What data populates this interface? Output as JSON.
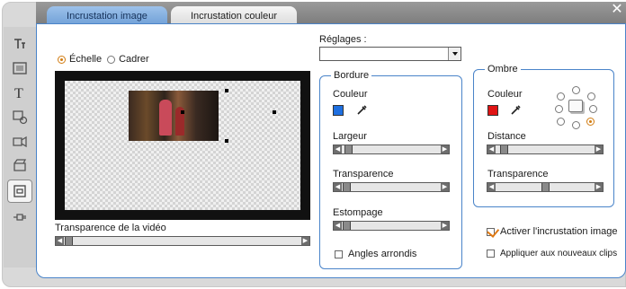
{
  "tabs": [
    {
      "label": "Incrustation image",
      "active": true
    },
    {
      "label": "Incrustation couleur",
      "active": false
    }
  ],
  "sidebar": {
    "icons": [
      "title-tool-icon",
      "frame-tool-icon",
      "text-tool-icon",
      "sound-tool-icon",
      "camera-tool-icon",
      "clapper-tool-icon",
      "overlay-tool-icon",
      "plug-tool-icon"
    ],
    "active_index": 6
  },
  "placement": {
    "option_scale": "Échelle",
    "option_crop": "Cadrer",
    "selected": "scale"
  },
  "video_transparency": {
    "label": "Transparence de la vidéo",
    "value": 0.02
  },
  "presets": {
    "label": "Réglages :",
    "selected": ""
  },
  "border": {
    "legend": "Bordure",
    "color_label": "Couleur",
    "color": "#1e6fe0",
    "width_label": "Largeur",
    "width": 0.06,
    "transparency_label": "Transparence",
    "transparency": 0.02,
    "soften_label": "Estompage",
    "soften": 0.02,
    "rounded_label": "Angles arrondis",
    "rounded": false
  },
  "shadow": {
    "legend": "Ombre",
    "color_label": "Couleur",
    "color": "#e01414",
    "distance_label": "Distance",
    "distance": 0.08,
    "transparency_label": "Transparence",
    "transparency": 0.5,
    "direction_selected": "bottom-right"
  },
  "enable_overlay": {
    "label": "Activer l'incrustation image",
    "checked": true
  },
  "apply_new_clips": {
    "label": "Appliquer aux nouveaux clips",
    "checked": false
  }
}
